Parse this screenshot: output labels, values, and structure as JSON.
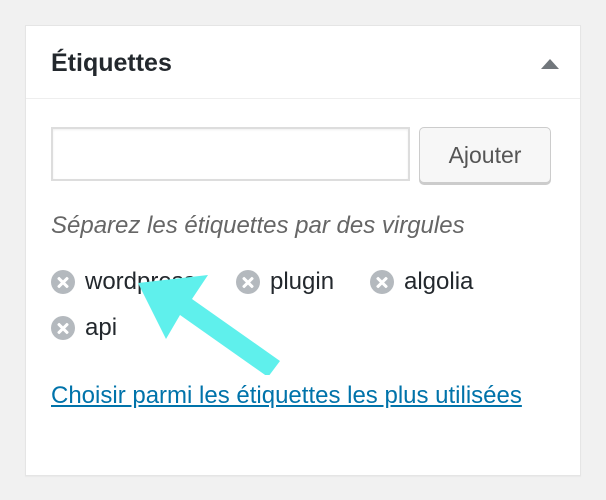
{
  "metabox": {
    "title": "Étiquettes",
    "toggle_icon": "triangle-up-icon"
  },
  "tag_form": {
    "input_value": "",
    "input_placeholder": "",
    "add_button_label": "Ajouter"
  },
  "help_text": "Séparez les étiquettes par des virgules",
  "tags": [
    {
      "label": "wordpress",
      "icon": "remove-circle-icon"
    },
    {
      "label": "plugin",
      "icon": "remove-circle-icon"
    },
    {
      "label": "algolia",
      "icon": "remove-circle-icon"
    },
    {
      "label": "api",
      "icon": "remove-circle-icon"
    }
  ],
  "popular_link": "Choisir parmi les étiquettes les plus utilisées",
  "colors": {
    "link": "#0073aa",
    "arrow": "#5ff0ec",
    "remove_icon": "#b4b9be"
  }
}
